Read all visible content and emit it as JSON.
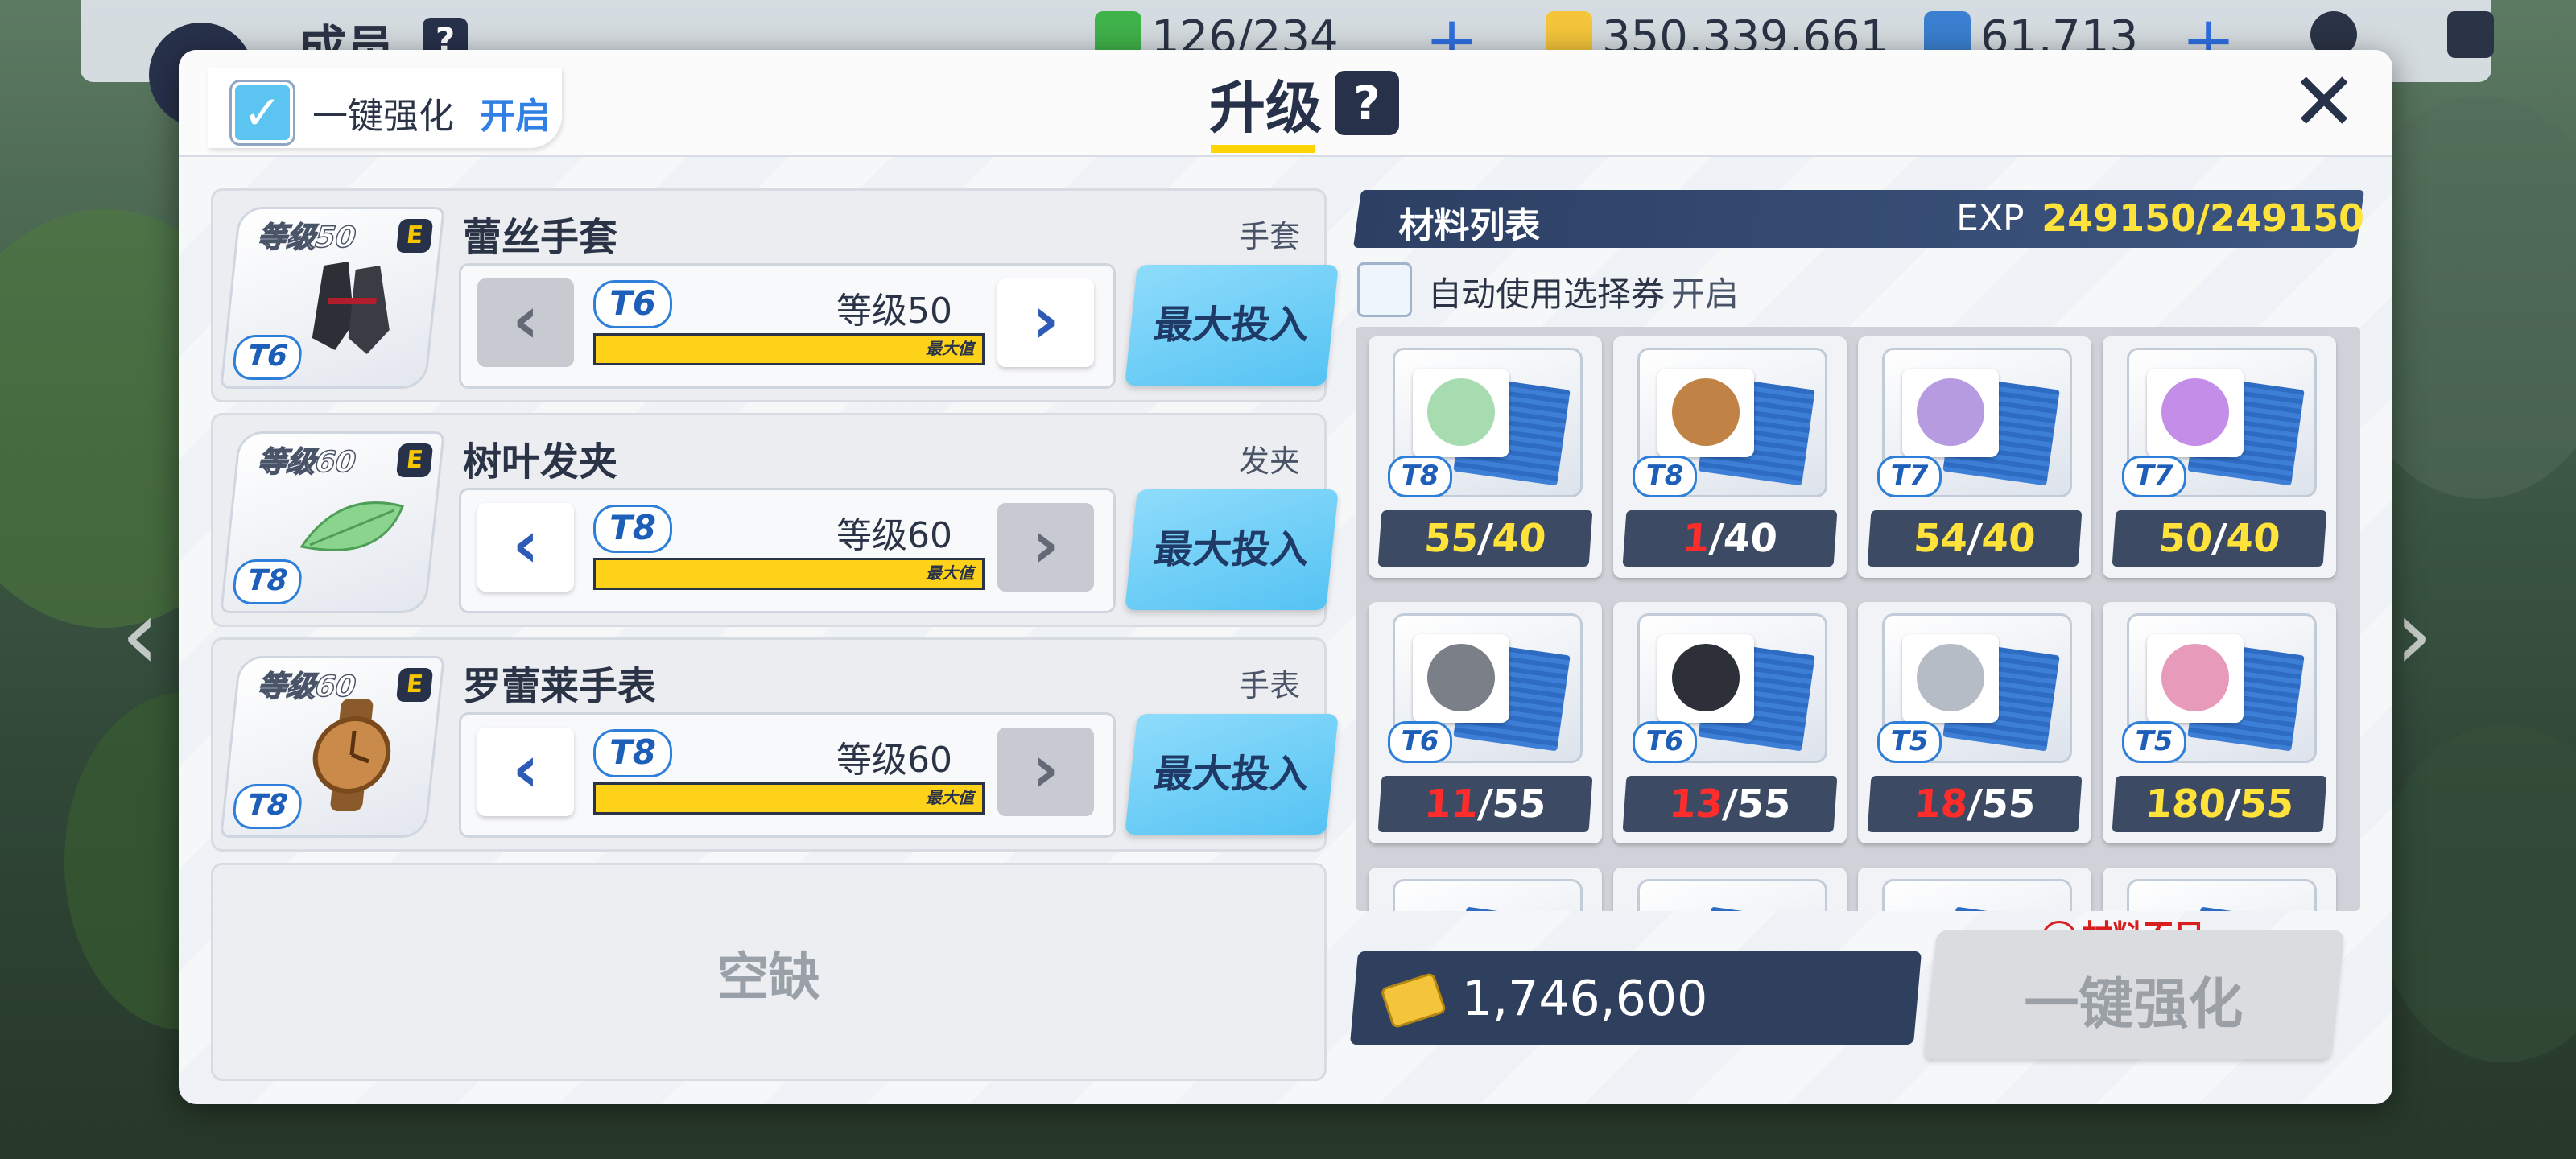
{
  "topbar": {
    "title": "成员",
    "help": "?",
    "resources": [
      {
        "name": "stamina",
        "value": "126/234",
        "icon": "stamina-icon",
        "color": "#3fb24a"
      },
      {
        "name": "credits",
        "value": "350,339,661",
        "icon": "credit-card-icon",
        "color": "#f4c53a"
      },
      {
        "name": "pyroxene",
        "value": "61,713",
        "icon": "gem-icon",
        "color": "#3a7fd0"
      }
    ]
  },
  "dialog": {
    "title": "升级",
    "help": "?",
    "close": "✕",
    "auto_strengthen": {
      "label": "一键强化",
      "state": "开启"
    }
  },
  "equipment": [
    {
      "name": "蕾丝手套",
      "slot": "手套",
      "level_badge": "等级50",
      "grade": "E",
      "tier": "T6",
      "level_text": "等级50",
      "bar_label": "最大值",
      "art_color": "#2d2f36",
      "left_disabled": true,
      "right_disabled": false
    },
    {
      "name": "树叶发夹",
      "slot": "发夹",
      "level_badge": "等级60",
      "grade": "E",
      "tier": "T8",
      "level_text": "等级60",
      "bar_label": "最大值",
      "art_color": "#8ad48e",
      "left_disabled": false,
      "right_disabled": true
    },
    {
      "name": "罗蕾莱手表",
      "slot": "手表",
      "level_badge": "等级60",
      "grade": "E",
      "tier": "T8",
      "level_text": "等级60",
      "bar_label": "最大值",
      "art_color": "#b8763c",
      "left_disabled": false,
      "right_disabled": true
    }
  ],
  "max_invest_label": "最大投入",
  "empty_slot": "空缺",
  "materials": {
    "title": "材料列表",
    "exp_label": "EXP",
    "exp_value": "249150/249150",
    "auto_coupon": {
      "label": "自动使用选择券",
      "state": "开启"
    },
    "items": [
      {
        "tier": "T8",
        "have": "55",
        "need": "40",
        "enough": true,
        "art": "leaf-icon",
        "color": "#a7dcb0"
      },
      {
        "tier": "T8",
        "have": "1",
        "need": "40",
        "enough": false,
        "art": "watch-icon",
        "color": "#c08345"
      },
      {
        "tier": "T7",
        "have": "54",
        "need": "40",
        "enough": true,
        "art": "watch-icon",
        "color": "#b79be0"
      },
      {
        "tier": "T7",
        "have": "50",
        "need": "40",
        "enough": true,
        "art": "badge-icon",
        "color": "#c48de8"
      },
      {
        "tier": "T6",
        "have": "11",
        "need": "55",
        "enough": false,
        "art": "watch-icon",
        "color": "#7a7f88"
      },
      {
        "tier": "T6",
        "have": "13",
        "need": "55",
        "enough": false,
        "art": "glove-icon",
        "color": "#2e3039"
      },
      {
        "tier": "T5",
        "have": "18",
        "need": "55",
        "enough": false,
        "art": "hairpin-icon",
        "color": "#b6bcc6"
      },
      {
        "tier": "T5",
        "have": "180",
        "need": "55",
        "enough": true,
        "art": "watch-icon",
        "color": "#e79ab9"
      }
    ]
  },
  "cost": "1,746,600",
  "strengthen_button": "一键强化",
  "warning": "材料不足。",
  "warning_icon": "!"
}
